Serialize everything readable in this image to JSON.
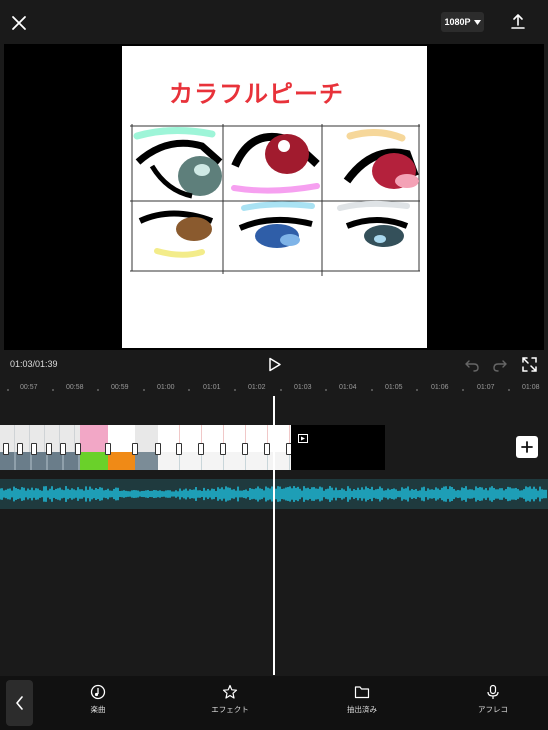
{
  "header": {
    "resolution": "1080P"
  },
  "preview": {
    "title_text": "カラフルピーチ"
  },
  "controls": {
    "timecode": "01:03/01:39"
  },
  "ruler": {
    "ticks": [
      "00:57",
      "00:58",
      "00:59",
      "01:00",
      "01:01",
      "01:02",
      "01:03",
      "01:04",
      "01:05",
      "01:06",
      "01:07",
      "01:08"
    ]
  },
  "toolbar": {
    "music_label": "楽曲",
    "effect_label": "エフェクト",
    "extracted_label": "抽出済み",
    "voiceover_label": "アフレコ"
  },
  "colors": {
    "title_red": "#e8323a",
    "audio_wave": "#1fb8d4",
    "accent_white": "#ffffff"
  }
}
